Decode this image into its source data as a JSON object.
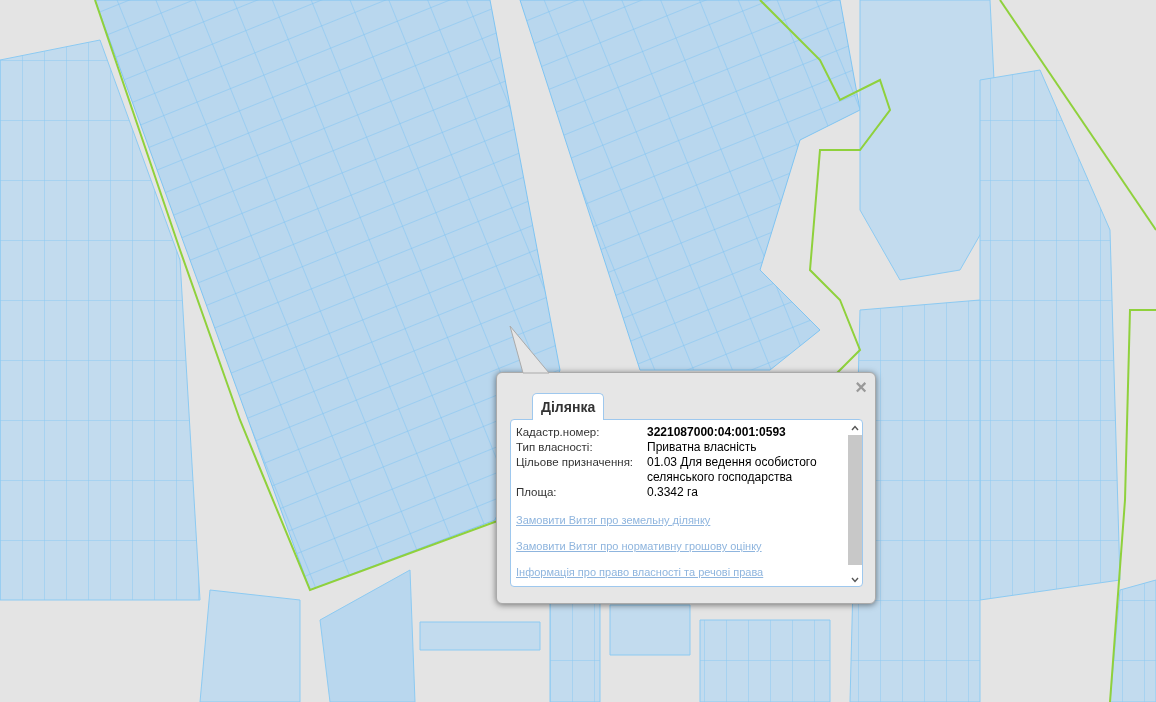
{
  "popup": {
    "close": "×",
    "tabs": [
      {
        "label": "Ділянка",
        "selected": true
      }
    ],
    "fields": [
      {
        "label": "Кадастр.номер:",
        "value": "3221087000:04:001:0593",
        "emphasis": true
      },
      {
        "label": "Тип власності:",
        "value": "Приватна власність",
        "emphasis": false
      },
      {
        "label": "Цільове призначення:",
        "value": "01.03 Для ведення особистого селянського господарства",
        "emphasis": false
      },
      {
        "label": "Площа:",
        "value": "0.3342 га",
        "emphasis": false
      }
    ],
    "links": [
      "Замовити Витяг про земельну ділянку",
      "Замовити Витяг про нормативну грошову оцінку",
      "Інформація про право власності та речові права"
    ]
  }
}
